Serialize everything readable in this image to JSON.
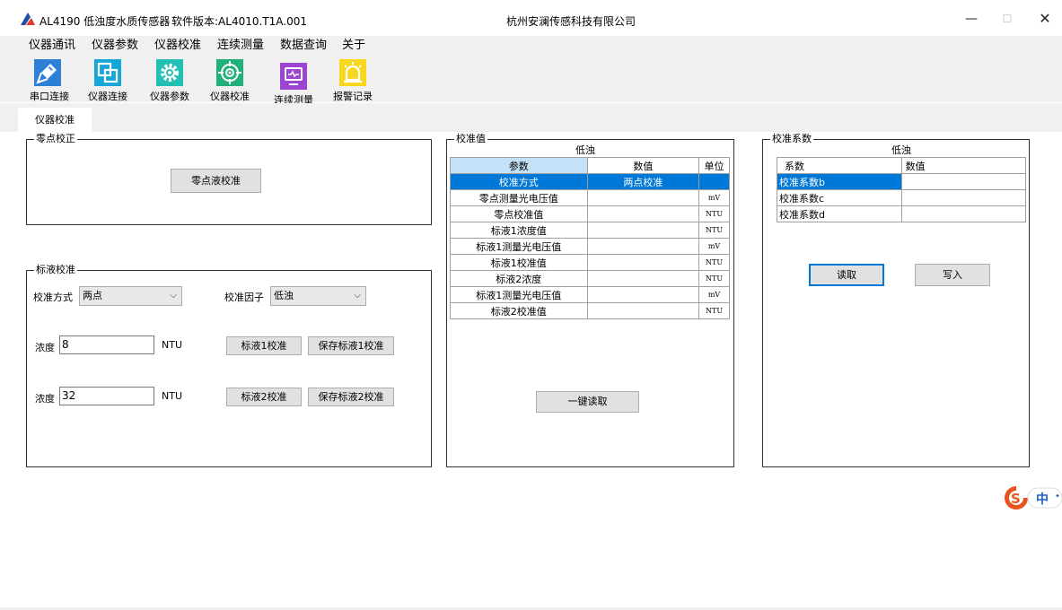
{
  "window": {
    "app_title": "AL4190 低浊度水质传感器",
    "version": "软件版本:AL4010.T1A.001",
    "company": "杭州安澜传感科技有限公司",
    "min_glyph": "—",
    "max_glyph": "☐",
    "close_glyph": "✕"
  },
  "menu": [
    "仪器通讯",
    "仪器参数",
    "仪器校准",
    "连续测量",
    "数据查询",
    "关于"
  ],
  "toolbar": [
    {
      "label": "串口连接",
      "icon": "plug-icon",
      "color": "#2e7fd6"
    },
    {
      "label": "仪器连接",
      "icon": "device-link-icon",
      "color": "#17a6d8"
    },
    {
      "label": "仪器参数",
      "icon": "gear-icon",
      "color": "#22c0b4"
    },
    {
      "label": "仪器校准",
      "icon": "target-icon",
      "color": "#22b07a"
    },
    {
      "label": "连续测量",
      "icon": "monitor-icon",
      "color": "#9b45d1"
    },
    {
      "label": "报警记录",
      "icon": "alarm-icon",
      "color": "#f6d71e"
    }
  ],
  "tab": {
    "active": "仪器校准"
  },
  "zero_cal": {
    "title": "零点校正",
    "button": "零点液校准"
  },
  "std_cal": {
    "title": "标液校准",
    "method_label": "校准方式",
    "method_value": "两点",
    "factor_label": "校准因子",
    "factor_value": "低浊",
    "conc_label": "浓度",
    "conc1_value": "8",
    "conc2_value": "32",
    "unit": "NTU",
    "btn_std1": "标液1校准",
    "btn_save1": "保存标液1校准",
    "btn_std2": "标液2校准",
    "btn_save2": "保存标液2校准"
  },
  "cal_values": {
    "title": "校准值",
    "caption": "低浊",
    "headers": [
      "参数",
      "数值",
      "单位"
    ],
    "rows": [
      {
        "param": "校准方式",
        "value": "两点校准",
        "unit": ""
      },
      {
        "param": "零点测量光电压值",
        "value": "",
        "unit": "mV"
      },
      {
        "param": "零点校准值",
        "value": "",
        "unit": "NTU"
      },
      {
        "param": "标液1浓度值",
        "value": "",
        "unit": "NTU"
      },
      {
        "param": "标液1测量光电压值",
        "value": "",
        "unit": "mV"
      },
      {
        "param": "标液1校准值",
        "value": "",
        "unit": "NTU"
      },
      {
        "param": "标液2浓度",
        "value": "",
        "unit": "NTU"
      },
      {
        "param": "标液1测量光电压值",
        "value": "",
        "unit": "mV"
      },
      {
        "param": "标液2校准值",
        "value": "",
        "unit": "NTU"
      }
    ],
    "read_all_button": "一键读取"
  },
  "cal_coef": {
    "title": "校准系数",
    "caption": "低浊",
    "headers": [
      "系数",
      "数值"
    ],
    "rows": [
      {
        "name": "校准系数b",
        "value": ""
      },
      {
        "name": "校准系数c",
        "value": ""
      },
      {
        "name": "校准系数d",
        "value": ""
      }
    ],
    "read_button": "读取",
    "write_button": "写入"
  },
  "ime": {
    "lang": "中",
    "brand_color": "#e8541e"
  }
}
